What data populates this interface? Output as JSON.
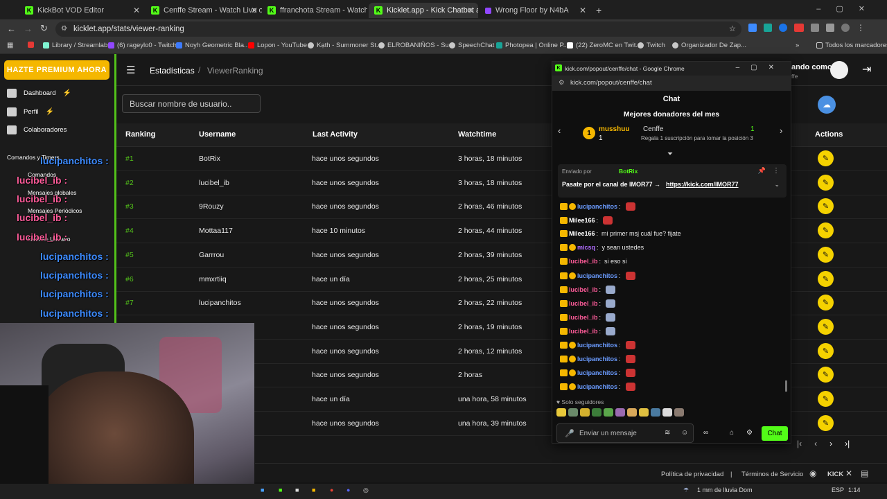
{
  "browser": {
    "tabs": [
      {
        "label": "KickBot VOD Editor",
        "icon": "kick-favicon"
      },
      {
        "label": "Cenffe Stream - Watch Live on",
        "icon": "kick-favicon"
      },
      {
        "label": "ffranchota Stream - Watch",
        "icon": "kick-favicon"
      },
      {
        "label": "Kicklet.app - Kick Chatbot and",
        "icon": "kick-favicon"
      },
      {
        "label": "Wrong Floor by N4bA",
        "icon": "music-favicon"
      }
    ],
    "new_tab": "+",
    "url": "kicklet.app/stats/viewer-ranking",
    "bookmarks": [
      {
        "label": "Library / Streamlabs",
        "color": "#80f5d2"
      },
      {
        "label": "(6) rageylo0 - Twitch",
        "color": "#9147ff"
      },
      {
        "label": "Noyh Geometric Bla...",
        "color": "#3d7bff"
      },
      {
        "label": "Lopon - YouTube",
        "color": "#ff0000"
      },
      {
        "label": "Kạth - Summoner St...",
        "color": "#c8c8c8"
      },
      {
        "label": "ELROBANIÑOS - Su...",
        "color": "#c8c8c8"
      },
      {
        "label": "SpeechChat",
        "color": "#c8c8c8"
      },
      {
        "label": "Photopea | Online P...",
        "color": "#18a497"
      },
      {
        "label": "(22) ZeroMC en Twit...",
        "color": "#ffffff"
      },
      {
        "label": "Twitch",
        "color": "#c8c8c8"
      },
      {
        "label": "Organizador De Zap...",
        "color": "#c8c8c8"
      }
    ],
    "all_bookmarks": "Todos los marcadores"
  },
  "sidebar": {
    "premium_label": "HAZTE PREMIUM AHORA",
    "items": [
      {
        "label": "Dashboard",
        "icon": "dashboard-icon"
      },
      {
        "label": "Perfil",
        "icon": "profile-icon"
      },
      {
        "label": "Colaboradores",
        "icon": "collaborators-icon"
      }
    ],
    "section": "Comandos y Timers",
    "sub_items": [
      "Comandos",
      "Mensajes globales",
      "Mensajes Periódicos",
      "Lista de Usuario"
    ]
  },
  "header": {
    "crumb_root": "Estadísticas",
    "crumb_sep": "/",
    "crumb_current": "ViewerRanking",
    "user_text": "ando como",
    "user_sub": "ffe"
  },
  "search": {
    "placeholder": "Buscar nombre de usuario.."
  },
  "table": {
    "headers": [
      "Ranking",
      "Username",
      "Last Activity",
      "Watchtime",
      "Actions"
    ],
    "rows": [
      {
        "rank": "#1",
        "username": "BotRix",
        "last": "hace unos segundos",
        "watch": "3 horas, 18 minutos"
      },
      {
        "rank": "#2",
        "username": "lucibel_ib",
        "last": "hace unos segundos",
        "watch": "3 horas, 18 minutos"
      },
      {
        "rank": "#3",
        "username": "9Rouzy",
        "last": "hace unos segundos",
        "watch": "2 horas, 46 minutos"
      },
      {
        "rank": "#4",
        "username": "Mottaa117",
        "last": "hace 10 minutos",
        "watch": "2 horas, 44 minutos"
      },
      {
        "rank": "#5",
        "username": "Garrrou",
        "last": "hace unos segundos",
        "watch": "2 horas, 39 minutos"
      },
      {
        "rank": "#6",
        "username": "mmxrtiiq",
        "last": "hace un día",
        "watch": "2 horas, 25 minutos"
      },
      {
        "rank": "#7",
        "username": "lucipanchitos",
        "last": "hace unos segundos",
        "watch": "2 horas, 22 minutos"
      },
      {
        "rank": "",
        "username": "",
        "last": "hace unos segundos",
        "watch": "2 horas, 19 minutos"
      },
      {
        "rank": "",
        "username": "",
        "last": "hace unos segundos",
        "watch": "2 horas, 12 minutos"
      },
      {
        "rank": "",
        "username": "",
        "last": "hace unos segundos",
        "watch": "2 horas"
      },
      {
        "rank": "",
        "username": "",
        "last": "hace un día",
        "watch": "una hora, 58 minutos"
      },
      {
        "rank": "",
        "username": "",
        "last": "hace unos segundos",
        "watch": "una hora, 39 minutos"
      }
    ]
  },
  "footer": {
    "privacy": "Política de privacidad",
    "sep": "|",
    "terms": "Términos de Servicio",
    "kick": "KICK"
  },
  "overlay": {
    "lines": [
      "lucipanchitos :",
      "lucibel_ib :",
      "lucibel_ib :",
      "lucibel_ib :",
      "lucibel_ib :",
      "lucipanchitos :",
      "lucipanchitos :",
      "lucipanchitos :",
      "lucipanchitos :"
    ]
  },
  "popup": {
    "window_title": "kick.com/popout/cenffe/chat - Google Chrome",
    "url": "kick.com/popout/cenffe/chat",
    "chat_label": "Chat",
    "donors_title": "Mejores donadores del mes",
    "donor_name": "musshuu",
    "donor_count": "1",
    "channel_name": "Cenffe",
    "channel_count": "1",
    "gift_hint": "Regala 1 suscripción para tomar la posición 3",
    "pinned_by": "Enviado por",
    "pinned_user": "BotRix",
    "pinned_text": "Pasate por el canal de IMOR77 →",
    "pinned_link": "https://kick.com/IMOR77",
    "messages": [
      {
        "user": "lucipanchitos",
        "text": "",
        "color": "blue"
      },
      {
        "user": "Milee166",
        "text": "",
        "color": "white"
      },
      {
        "user": "Milee166",
        "text": "mi primer msj cuál fue? fijate",
        "color": "white"
      },
      {
        "user": "micsq",
        "text": "y sean ustedes",
        "color": "purple"
      },
      {
        "user": "lucibel_ib",
        "text": "si eso si",
        "color": "pink"
      },
      {
        "user": "lucipanchitos",
        "text": "",
        "color": "blue"
      },
      {
        "user": "lucibel_ib",
        "text": "",
        "color": "pink"
      },
      {
        "user": "lucibel_ib",
        "text": "",
        "color": "pink"
      },
      {
        "user": "lucibel_ib",
        "text": "",
        "color": "pink"
      },
      {
        "user": "lucibel_ib",
        "text": "",
        "color": "pink"
      },
      {
        "user": "lucipanchitos",
        "text": "",
        "color": "blue"
      },
      {
        "user": "lucipanchitos",
        "text": "",
        "color": "blue"
      },
      {
        "user": "lucipanchitos",
        "text": "",
        "color": "blue"
      },
      {
        "user": "lucipanchitos",
        "text": "",
        "color": "blue"
      }
    ],
    "followers_only": "Solo seguidores",
    "input_placeholder": "Enviar un mensaje",
    "send_label": "Chat"
  },
  "taskbar": {
    "weather": "1 mm de lluvia Dom",
    "lang": "ESP",
    "time": "1:14"
  },
  "colors": {
    "accent": "#53fc18",
    "premium": "#f5b700",
    "action": "#f5d200"
  }
}
